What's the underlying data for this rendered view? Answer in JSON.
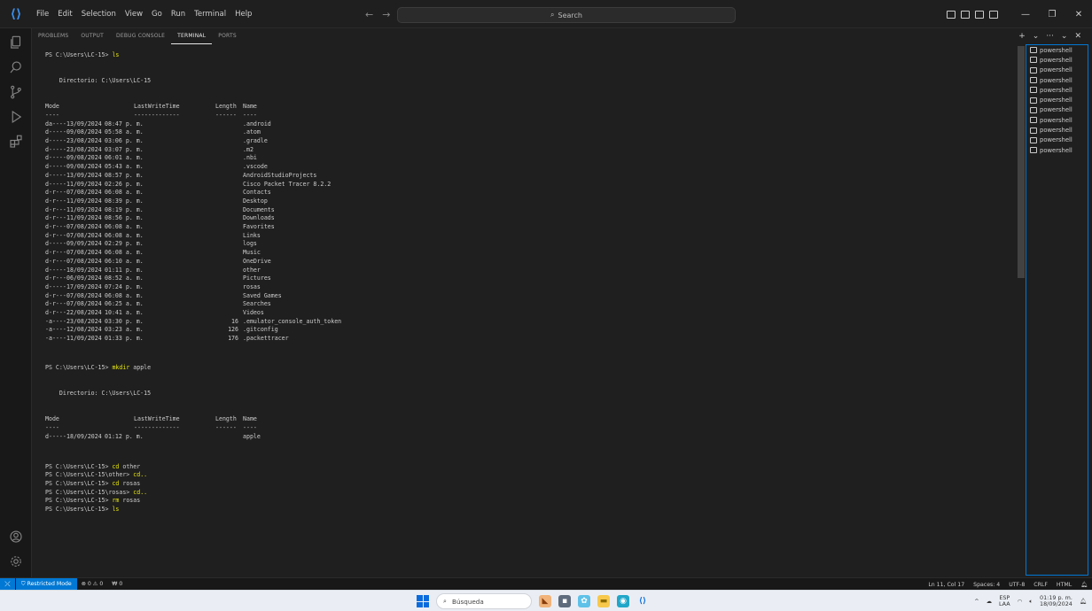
{
  "window": {
    "menu": [
      "File",
      "Edit",
      "Selection",
      "View",
      "Go",
      "Run",
      "Terminal",
      "Help"
    ],
    "search_placeholder": "Search"
  },
  "panel": {
    "tabs": [
      "PROBLEMS",
      "OUTPUT",
      "DEBUG CONSOLE",
      "TERMINAL",
      "PORTS"
    ],
    "active_tab": "TERMINAL"
  },
  "terminal": {
    "prompt": "PS C:\\Users\\LC-15>",
    "cmd1": "ls",
    "directory_line": "    Directorio: C:\\Users\\LC-15",
    "headers": {
      "mode": "Mode",
      "lastwrite": "LastWriteTime",
      "length": "Length",
      "name": "Name"
    },
    "dashes": {
      "mode": "----",
      "lastwrite": "-------------",
      "length": "------",
      "name": "----"
    },
    "entries": [
      {
        "mode": "da----",
        "date": "13/09/2024",
        "time": "08:47 p. m.",
        "length": "",
        "name": ".android"
      },
      {
        "mode": "d-----",
        "date": "09/08/2024",
        "time": "05:58 a. m.",
        "length": "",
        "name": ".atom"
      },
      {
        "mode": "d-----",
        "date": "23/08/2024",
        "time": "03:06 p. m.",
        "length": "",
        "name": ".gradle"
      },
      {
        "mode": "d-----",
        "date": "23/08/2024",
        "time": "03:07 p. m.",
        "length": "",
        "name": ".m2"
      },
      {
        "mode": "d-----",
        "date": "09/08/2024",
        "time": "06:01 a. m.",
        "length": "",
        "name": ".nbi"
      },
      {
        "mode": "d-----",
        "date": "09/08/2024",
        "time": "05:43 a. m.",
        "length": "",
        "name": ".vscode"
      },
      {
        "mode": "d-----",
        "date": "13/09/2024",
        "time": "08:57 p. m.",
        "length": "",
        "name": "AndroidStudioProjects"
      },
      {
        "mode": "d-----",
        "date": "11/09/2024",
        "time": "02:26 p. m.",
        "length": "",
        "name": "Cisco Packet Tracer 8.2.2"
      },
      {
        "mode": "d-r---",
        "date": "07/08/2024",
        "time": "06:08 a. m.",
        "length": "",
        "name": "Contacts"
      },
      {
        "mode": "d-r---",
        "date": "11/09/2024",
        "time": "08:39 p. m.",
        "length": "",
        "name": "Desktop"
      },
      {
        "mode": "d-r---",
        "date": "11/09/2024",
        "time": "08:19 p. m.",
        "length": "",
        "name": "Documents"
      },
      {
        "mode": "d-r---",
        "date": "11/09/2024",
        "time": "08:56 p. m.",
        "length": "",
        "name": "Downloads"
      },
      {
        "mode": "d-r---",
        "date": "07/08/2024",
        "time": "06:08 a. m.",
        "length": "",
        "name": "Favorites"
      },
      {
        "mode": "d-r---",
        "date": "07/08/2024",
        "time": "06:08 a. m.",
        "length": "",
        "name": "Links"
      },
      {
        "mode": "d-----",
        "date": "09/09/2024",
        "time": "02:29 p. m.",
        "length": "",
        "name": "logs"
      },
      {
        "mode": "d-r---",
        "date": "07/08/2024",
        "time": "06:08 a. m.",
        "length": "",
        "name": "Music"
      },
      {
        "mode": "d-r---",
        "date": "07/08/2024",
        "time": "06:10 a. m.",
        "length": "",
        "name": "OneDrive"
      },
      {
        "mode": "d-----",
        "date": "18/09/2024",
        "time": "01:11 p. m.",
        "length": "",
        "name": "other"
      },
      {
        "mode": "d-r---",
        "date": "06/09/2024",
        "time": "08:52 a. m.",
        "length": "",
        "name": "Pictures"
      },
      {
        "mode": "d-----",
        "date": "17/09/2024",
        "time": "07:24 p. m.",
        "length": "",
        "name": "rosas"
      },
      {
        "mode": "d-r---",
        "date": "07/08/2024",
        "time": "06:08 a. m.",
        "length": "",
        "name": "Saved Games"
      },
      {
        "mode": "d-r---",
        "date": "07/08/2024",
        "time": "06:25 a. m.",
        "length": "",
        "name": "Searches"
      },
      {
        "mode": "d-r---",
        "date": "22/08/2024",
        "time": "10:41 a. m.",
        "length": "",
        "name": "Videos"
      },
      {
        "mode": "-a----",
        "date": "23/08/2024",
        "time": "03:30 p. m.",
        "length": "16",
        "name": ".emulator_console_auth_token"
      },
      {
        "mode": "-a----",
        "date": "12/08/2024",
        "time": "03:23 a. m.",
        "length": "126",
        "name": ".gitconfig"
      },
      {
        "mode": "-a----",
        "date": "11/09/2024",
        "time": "01:33 p. m.",
        "length": "176",
        "name": ".packettracer"
      }
    ],
    "cmd2_keyword": "mkdir",
    "cmd2_arg": " apple",
    "entries2": [
      {
        "mode": "d-----",
        "date": "18/09/2024",
        "time": "01:12 p. m.",
        "length": "",
        "name": "apple"
      }
    ],
    "tail": [
      {
        "prompt": "PS C:\\Users\\LC-15> ",
        "cmd": "cd",
        "arg": " other"
      },
      {
        "prompt": "PS C:\\Users\\LC-15\\other> ",
        "cmd": "cd..",
        "arg": ""
      },
      {
        "prompt": "PS C:\\Users\\LC-15> ",
        "cmd": "cd",
        "arg": " rosas"
      },
      {
        "prompt": "PS C:\\Users\\LC-15\\rosas> ",
        "cmd": "cd..",
        "arg": ""
      },
      {
        "prompt": "PS C:\\Users\\LC-15> ",
        "cmd": "rm",
        "arg": " rosas"
      },
      {
        "prompt": "PS C:\\Users\\LC-15> ",
        "cmd": "ls",
        "arg": ""
      }
    ]
  },
  "terminals": [
    "powershell",
    "powershell",
    "powershell",
    "powershell",
    "powershell",
    "powershell",
    "powershell",
    "powershell",
    "powershell",
    "powershell",
    "powershell"
  ],
  "status": {
    "restricted": "Restricted Mode",
    "problems": "⊗ 0 ⚠ 0",
    "ports": "₩ 0",
    "position": "Ln 11, Col 17",
    "spaces": "Spaces: 4",
    "encoding": "UTF-8",
    "eol": "CRLF",
    "language": "HTML"
  },
  "taskbar": {
    "search_label": "Búsqueda",
    "lang_top": "ESP",
    "lang_bottom": "LAA",
    "time": "01:19 p. m.",
    "date": "18/09/2024"
  }
}
